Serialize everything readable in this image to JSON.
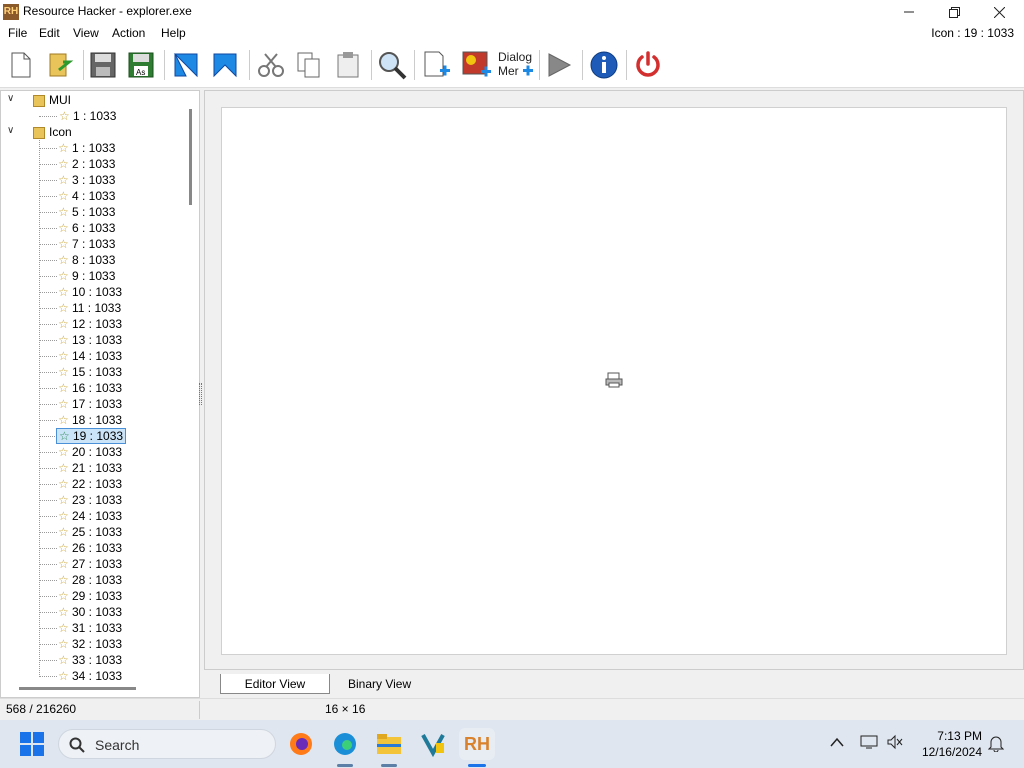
{
  "window": {
    "title": "Resource Hacker - explorer.exe",
    "logo_text": "RH"
  },
  "menu": {
    "items": [
      "File",
      "Edit",
      "View",
      "Action",
      "Help"
    ],
    "status_right": "Icon : 19 : 1033"
  },
  "toolbar": {
    "dialog_label_1": "Dialog",
    "dialog_label_2": "Mer"
  },
  "tree": {
    "mui_label": "MUI",
    "mui_child": "1 : 1033",
    "icon_label": "Icon",
    "icon_items": [
      "1 : 1033",
      "2 : 1033",
      "3 : 1033",
      "4 : 1033",
      "5 : 1033",
      "6 : 1033",
      "7 : 1033",
      "8 : 1033",
      "9 : 1033",
      "10 : 1033",
      "11 : 1033",
      "12 : 1033",
      "13 : 1033",
      "14 : 1033",
      "15 : 1033",
      "16 : 1033",
      "17 : 1033",
      "18 : 1033",
      "19 : 1033",
      "20 : 1033",
      "21 : 1033",
      "22 : 1033",
      "23 : 1033",
      "24 : 1033",
      "25 : 1033",
      "26 : 1033",
      "27 : 1033",
      "28 : 1033",
      "29 : 1033",
      "30 : 1033",
      "31 : 1033",
      "32 : 1033",
      "33 : 1033",
      "34 : 1033"
    ],
    "selected": "19 : 1033"
  },
  "tabs": {
    "editor_view": "Editor View",
    "binary_view": "Binary View"
  },
  "status": {
    "position": "568 / 216260",
    "size": "16 × 16"
  },
  "taskbar": {
    "search_label": "Search",
    "time": "7:13 PM",
    "date": "12/16/2024"
  },
  "colors": {
    "selection_bg": "#cce4f7",
    "selection_border": "#4a90d9",
    "taskbar_bg": "#dfe6ef"
  }
}
